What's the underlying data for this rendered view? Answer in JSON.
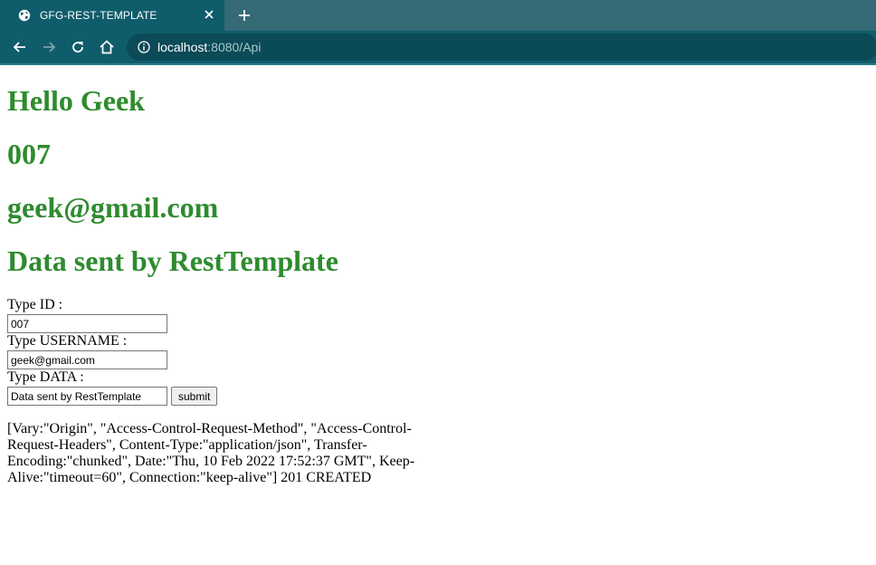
{
  "browser": {
    "tab_title": "GFG-REST-TEMPLATE",
    "url_host": "localhost",
    "url_rest": ":8080/Api",
    "colors": {
      "tabstrip": "#356a76",
      "toolbar": "#0f5c6b",
      "omnibox": "#0b4a57"
    }
  },
  "page": {
    "heading_1": "Hello Geek",
    "heading_2": "007",
    "heading_3": "geek@gmail.com",
    "heading_4": "Data sent by RestTemplate",
    "heading_color": "#2e8b2e",
    "form": {
      "id_label": "Type ID :",
      "id_value": "007",
      "username_label": "Type USERNAME :",
      "username_value": "geek@gmail.com",
      "data_label": "Type DATA :",
      "data_value": "Data sent by RestTemplate",
      "submit_label": "submit"
    },
    "response_text": "[Vary:\"Origin\", \"Access-Control-Request-Method\", \"Access-Control-Request-Headers\", Content-Type:\"application/json\", Transfer-Encoding:\"chunked\", Date:\"Thu, 10 Feb 2022 17:52:37 GMT\", Keep-Alive:\"timeout=60\", Connection:\"keep-alive\"] 201 CREATED"
  }
}
